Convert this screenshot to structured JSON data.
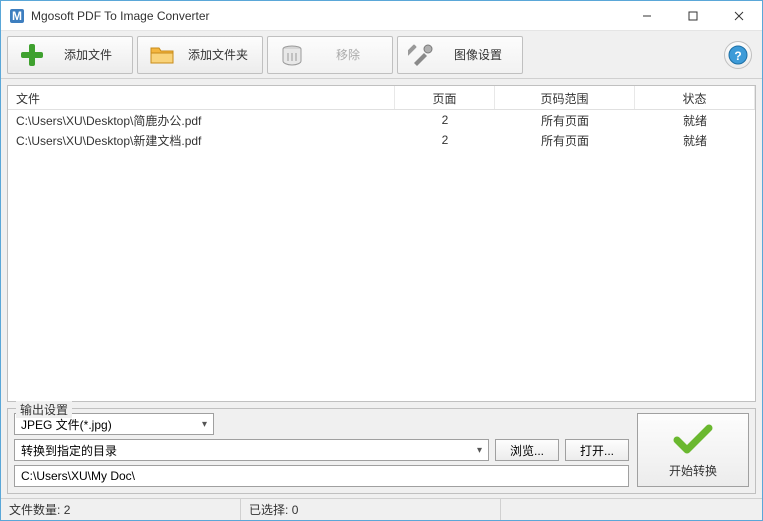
{
  "window": {
    "title": "Mgosoft PDF To Image Converter"
  },
  "toolbar": {
    "add_file": "添加文件",
    "add_folder": "添加文件夹",
    "remove": "移除",
    "image_settings": "图像设置"
  },
  "columns": {
    "file": "文件",
    "pages": "页面",
    "range": "页码范围",
    "status": "状态"
  },
  "rows": [
    {
      "file": "C:\\Users\\XU\\Desktop\\简鹿办公.pdf",
      "pages": "2",
      "range": "所有页面",
      "status": "就绪"
    },
    {
      "file": "C:\\Users\\XU\\Desktop\\新建文档.pdf",
      "pages": "2",
      "range": "所有页面",
      "status": "就绪"
    }
  ],
  "output": {
    "legend": "输出设置",
    "format": "JPEG 文件(*.jpg)",
    "dest_mode": "转换到指定的目录",
    "browse": "浏览...",
    "open": "打开...",
    "path": "C:\\Users\\XU\\My Doc\\",
    "start": "开始转换"
  },
  "status": {
    "count_label": "文件数量:",
    "count_value": "2",
    "selected_label": "已选择:",
    "selected_value": "0"
  }
}
